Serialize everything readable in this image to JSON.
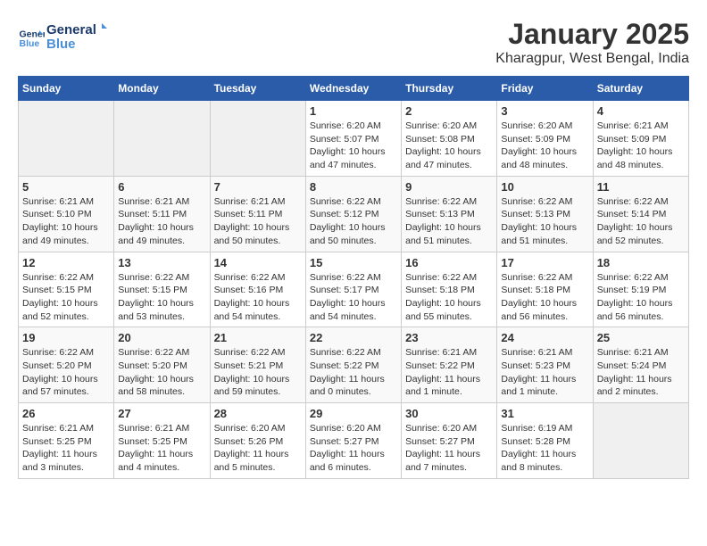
{
  "header": {
    "logo_line1": "General",
    "logo_line2": "Blue",
    "title": "January 2025",
    "subtitle": "Kharagpur, West Bengal, India"
  },
  "columns": [
    "Sunday",
    "Monday",
    "Tuesday",
    "Wednesday",
    "Thursday",
    "Friday",
    "Saturday"
  ],
  "weeks": [
    [
      {
        "day": "",
        "sunrise": "",
        "sunset": "",
        "daylight": ""
      },
      {
        "day": "",
        "sunrise": "",
        "sunset": "",
        "daylight": ""
      },
      {
        "day": "",
        "sunrise": "",
        "sunset": "",
        "daylight": ""
      },
      {
        "day": "1",
        "sunrise": "Sunrise: 6:20 AM",
        "sunset": "Sunset: 5:07 PM",
        "daylight": "Daylight: 10 hours and 47 minutes."
      },
      {
        "day": "2",
        "sunrise": "Sunrise: 6:20 AM",
        "sunset": "Sunset: 5:08 PM",
        "daylight": "Daylight: 10 hours and 47 minutes."
      },
      {
        "day": "3",
        "sunrise": "Sunrise: 6:20 AM",
        "sunset": "Sunset: 5:09 PM",
        "daylight": "Daylight: 10 hours and 48 minutes."
      },
      {
        "day": "4",
        "sunrise": "Sunrise: 6:21 AM",
        "sunset": "Sunset: 5:09 PM",
        "daylight": "Daylight: 10 hours and 48 minutes."
      }
    ],
    [
      {
        "day": "5",
        "sunrise": "Sunrise: 6:21 AM",
        "sunset": "Sunset: 5:10 PM",
        "daylight": "Daylight: 10 hours and 49 minutes."
      },
      {
        "day": "6",
        "sunrise": "Sunrise: 6:21 AM",
        "sunset": "Sunset: 5:11 PM",
        "daylight": "Daylight: 10 hours and 49 minutes."
      },
      {
        "day": "7",
        "sunrise": "Sunrise: 6:21 AM",
        "sunset": "Sunset: 5:11 PM",
        "daylight": "Daylight: 10 hours and 50 minutes."
      },
      {
        "day": "8",
        "sunrise": "Sunrise: 6:22 AM",
        "sunset": "Sunset: 5:12 PM",
        "daylight": "Daylight: 10 hours and 50 minutes."
      },
      {
        "day": "9",
        "sunrise": "Sunrise: 6:22 AM",
        "sunset": "Sunset: 5:13 PM",
        "daylight": "Daylight: 10 hours and 51 minutes."
      },
      {
        "day": "10",
        "sunrise": "Sunrise: 6:22 AM",
        "sunset": "Sunset: 5:13 PM",
        "daylight": "Daylight: 10 hours and 51 minutes."
      },
      {
        "day": "11",
        "sunrise": "Sunrise: 6:22 AM",
        "sunset": "Sunset: 5:14 PM",
        "daylight": "Daylight: 10 hours and 52 minutes."
      }
    ],
    [
      {
        "day": "12",
        "sunrise": "Sunrise: 6:22 AM",
        "sunset": "Sunset: 5:15 PM",
        "daylight": "Daylight: 10 hours and 52 minutes."
      },
      {
        "day": "13",
        "sunrise": "Sunrise: 6:22 AM",
        "sunset": "Sunset: 5:15 PM",
        "daylight": "Daylight: 10 hours and 53 minutes."
      },
      {
        "day": "14",
        "sunrise": "Sunrise: 6:22 AM",
        "sunset": "Sunset: 5:16 PM",
        "daylight": "Daylight: 10 hours and 54 minutes."
      },
      {
        "day": "15",
        "sunrise": "Sunrise: 6:22 AM",
        "sunset": "Sunset: 5:17 PM",
        "daylight": "Daylight: 10 hours and 54 minutes."
      },
      {
        "day": "16",
        "sunrise": "Sunrise: 6:22 AM",
        "sunset": "Sunset: 5:18 PM",
        "daylight": "Daylight: 10 hours and 55 minutes."
      },
      {
        "day": "17",
        "sunrise": "Sunrise: 6:22 AM",
        "sunset": "Sunset: 5:18 PM",
        "daylight": "Daylight: 10 hours and 56 minutes."
      },
      {
        "day": "18",
        "sunrise": "Sunrise: 6:22 AM",
        "sunset": "Sunset: 5:19 PM",
        "daylight": "Daylight: 10 hours and 56 minutes."
      }
    ],
    [
      {
        "day": "19",
        "sunrise": "Sunrise: 6:22 AM",
        "sunset": "Sunset: 5:20 PM",
        "daylight": "Daylight: 10 hours and 57 minutes."
      },
      {
        "day": "20",
        "sunrise": "Sunrise: 6:22 AM",
        "sunset": "Sunset: 5:20 PM",
        "daylight": "Daylight: 10 hours and 58 minutes."
      },
      {
        "day": "21",
        "sunrise": "Sunrise: 6:22 AM",
        "sunset": "Sunset: 5:21 PM",
        "daylight": "Daylight: 10 hours and 59 minutes."
      },
      {
        "day": "22",
        "sunrise": "Sunrise: 6:22 AM",
        "sunset": "Sunset: 5:22 PM",
        "daylight": "Daylight: 11 hours and 0 minutes."
      },
      {
        "day": "23",
        "sunrise": "Sunrise: 6:21 AM",
        "sunset": "Sunset: 5:22 PM",
        "daylight": "Daylight: 11 hours and 1 minute."
      },
      {
        "day": "24",
        "sunrise": "Sunrise: 6:21 AM",
        "sunset": "Sunset: 5:23 PM",
        "daylight": "Daylight: 11 hours and 1 minute."
      },
      {
        "day": "25",
        "sunrise": "Sunrise: 6:21 AM",
        "sunset": "Sunset: 5:24 PM",
        "daylight": "Daylight: 11 hours and 2 minutes."
      }
    ],
    [
      {
        "day": "26",
        "sunrise": "Sunrise: 6:21 AM",
        "sunset": "Sunset: 5:25 PM",
        "daylight": "Daylight: 11 hours and 3 minutes."
      },
      {
        "day": "27",
        "sunrise": "Sunrise: 6:21 AM",
        "sunset": "Sunset: 5:25 PM",
        "daylight": "Daylight: 11 hours and 4 minutes."
      },
      {
        "day": "28",
        "sunrise": "Sunrise: 6:20 AM",
        "sunset": "Sunset: 5:26 PM",
        "daylight": "Daylight: 11 hours and 5 minutes."
      },
      {
        "day": "29",
        "sunrise": "Sunrise: 6:20 AM",
        "sunset": "Sunset: 5:27 PM",
        "daylight": "Daylight: 11 hours and 6 minutes."
      },
      {
        "day": "30",
        "sunrise": "Sunrise: 6:20 AM",
        "sunset": "Sunset: 5:27 PM",
        "daylight": "Daylight: 11 hours and 7 minutes."
      },
      {
        "day": "31",
        "sunrise": "Sunrise: 6:19 AM",
        "sunset": "Sunset: 5:28 PM",
        "daylight": "Daylight: 11 hours and 8 minutes."
      },
      {
        "day": "",
        "sunrise": "",
        "sunset": "",
        "daylight": ""
      }
    ]
  ]
}
